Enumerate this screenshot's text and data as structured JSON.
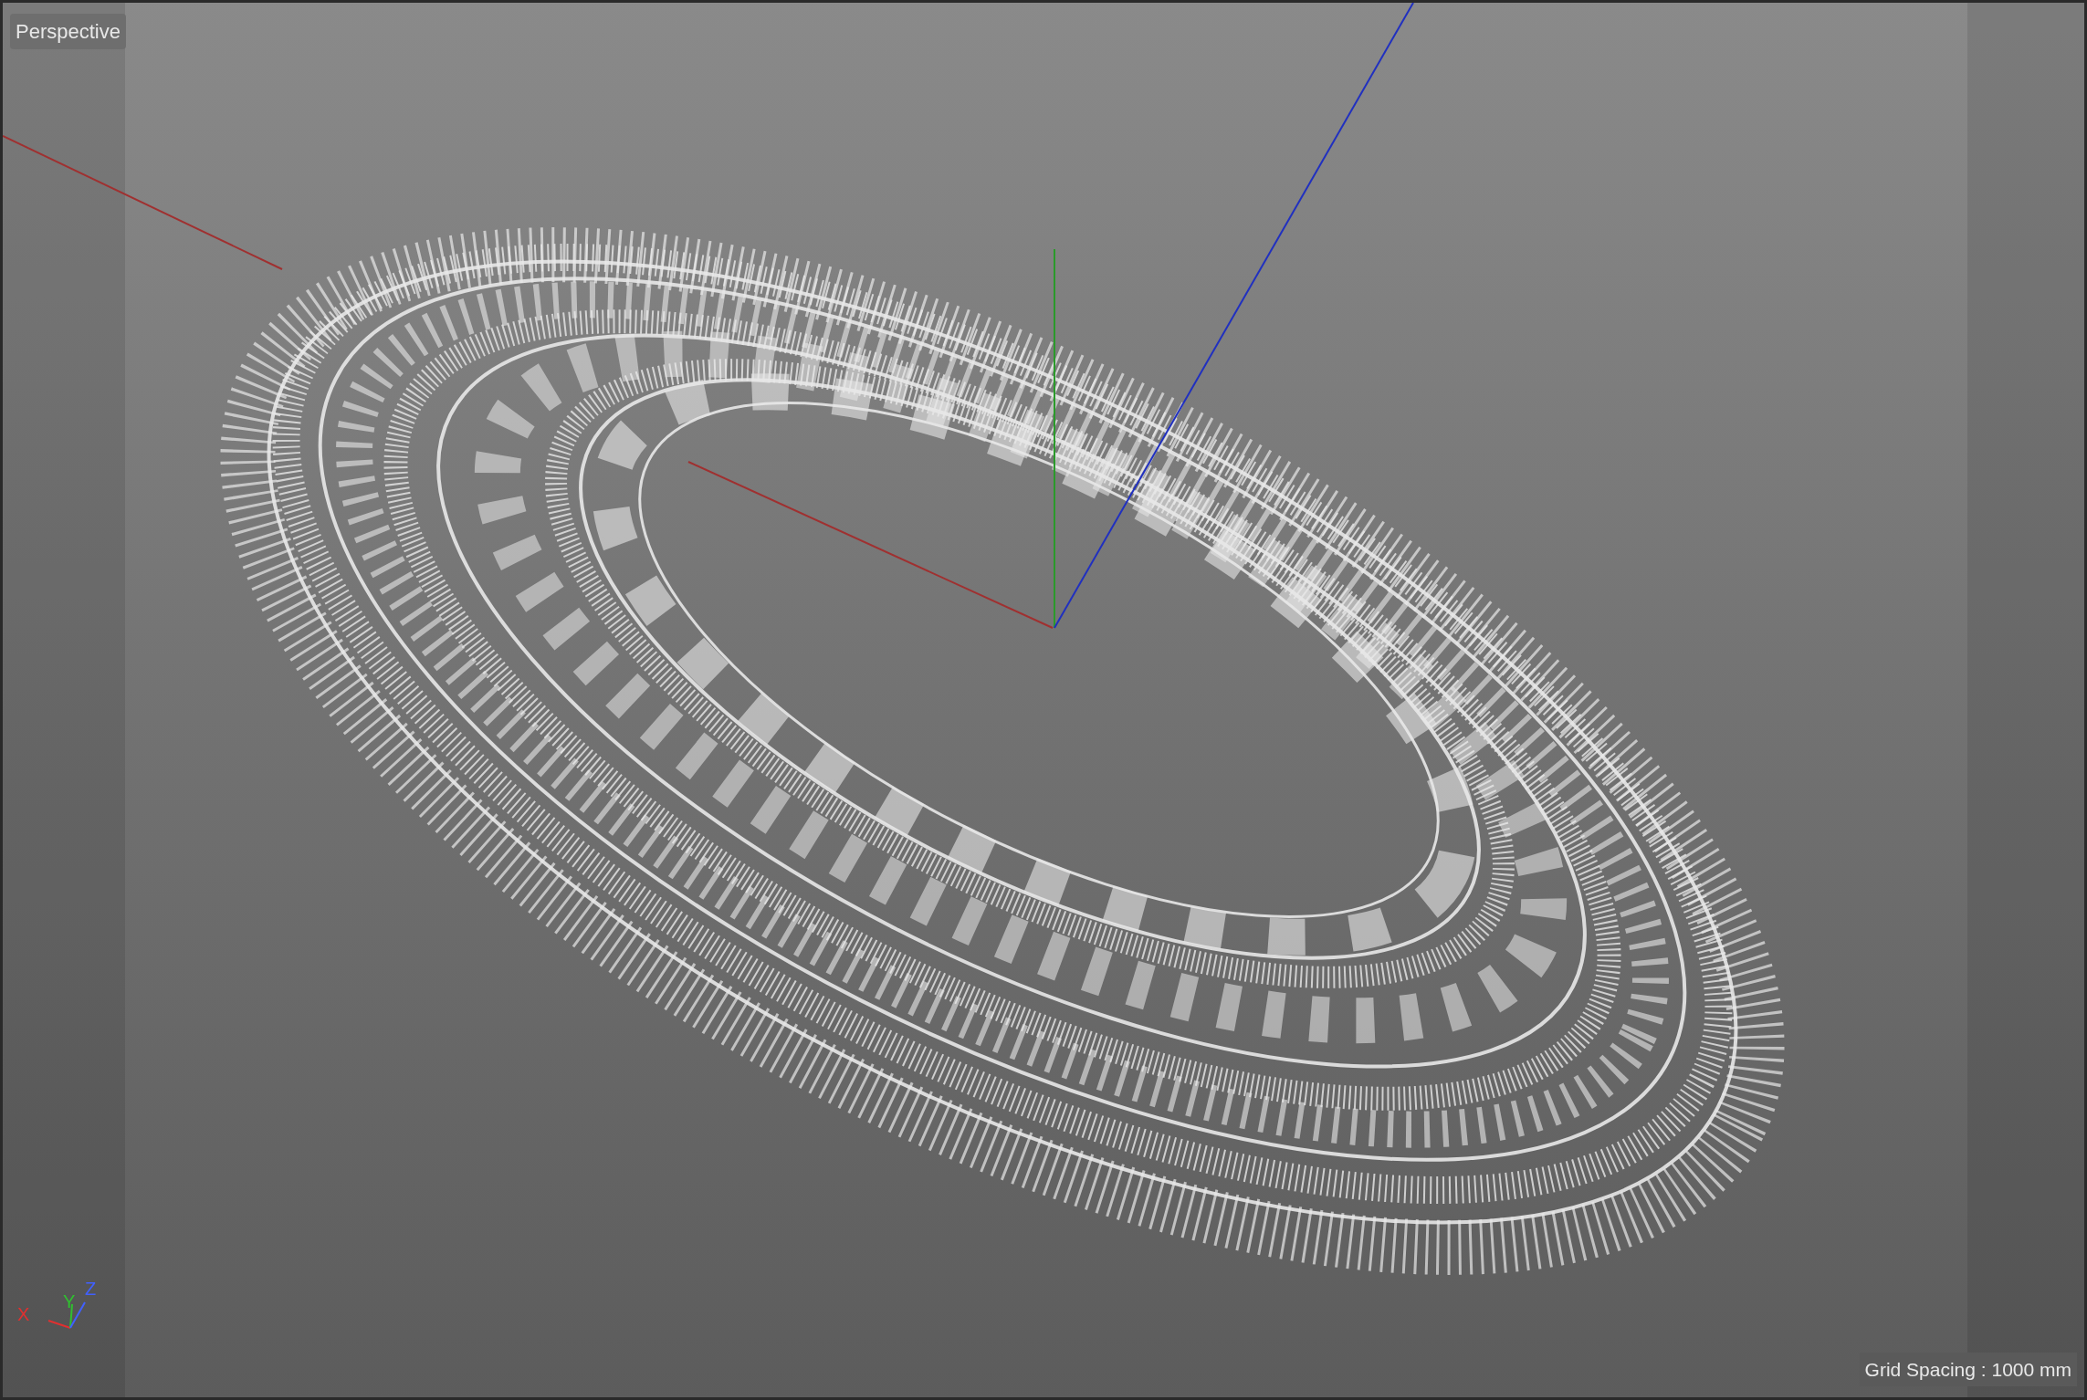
{
  "viewport": {
    "camera_label": "Perspective",
    "grid_spacing": "Grid Spacing : 1000 mm",
    "axis_gizmo": [
      {
        "label": "X",
        "color": "#e03030"
      },
      {
        "label": "Y",
        "color": "#30c030"
      },
      {
        "label": "Z",
        "color": "#4060ff"
      }
    ]
  }
}
